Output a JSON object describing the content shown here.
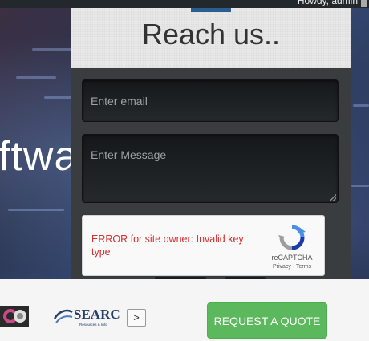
{
  "adminbar": {
    "howdy": "Howdy, admin"
  },
  "hero": {
    "text": "ftwa"
  },
  "contact": {
    "title": "Reach us..",
    "email_placeholder": "Enter email",
    "message_placeholder": "Enter Message"
  },
  "recaptcha": {
    "error": "ERROR for site owner: Invalid key type",
    "brand": "reCAPTCHA",
    "privacy": "Privacy",
    "separator": " - ",
    "terms": "Terms"
  },
  "footer": {
    "searc_name": "SEARC",
    "searc_sub": "Resources & Info",
    "next_label": ">",
    "quote_label": "REQUEST A QUOTE"
  },
  "colors": {
    "quote_button": "#5cb85c",
    "error_text": "#d32f2f",
    "panel": "#3a3d40"
  }
}
